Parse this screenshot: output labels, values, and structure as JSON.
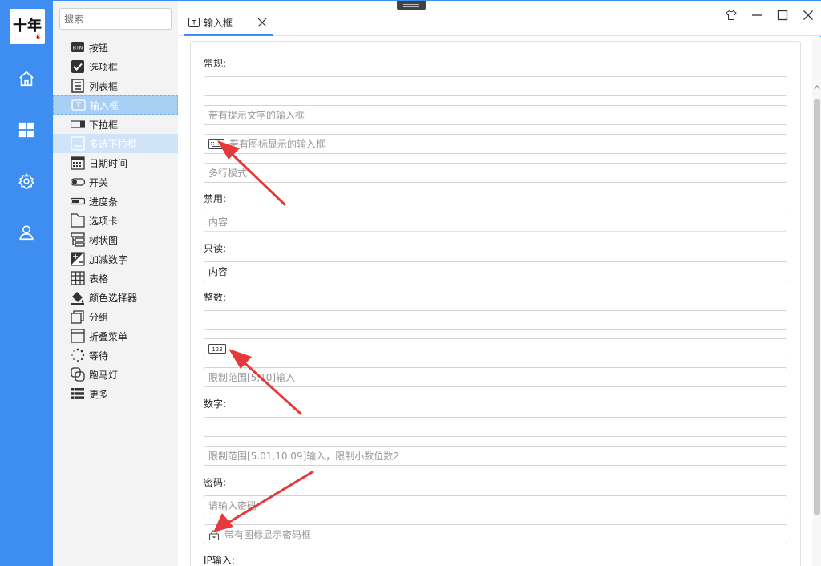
{
  "logo": {
    "text": "十年",
    "sub": "6"
  },
  "rail": {
    "items": [
      "home-icon",
      "dashboard-icon",
      "settings-icon",
      "user-icon"
    ]
  },
  "sidebar": {
    "search_placeholder": "搜索",
    "items": [
      {
        "label": "按钮",
        "icon": "btn-icon"
      },
      {
        "label": "选项框",
        "icon": "checkbox-icon"
      },
      {
        "label": "列表框",
        "icon": "listbox-icon"
      },
      {
        "label": "输入框",
        "icon": "textbox-icon",
        "active": true
      },
      {
        "label": "下拉框",
        "icon": "dropdown-icon"
      },
      {
        "label": "多选下拉框",
        "icon": "multiselect-icon",
        "hover": true
      },
      {
        "label": "日期时间",
        "icon": "calendar-icon"
      },
      {
        "label": "开关",
        "icon": "toggle-icon"
      },
      {
        "label": "进度条",
        "icon": "progress-icon"
      },
      {
        "label": "选项卡",
        "icon": "tab-icon"
      },
      {
        "label": "树状图",
        "icon": "tree-icon"
      },
      {
        "label": "加减数字",
        "icon": "plusminus-icon"
      },
      {
        "label": "表格",
        "icon": "table-icon"
      },
      {
        "label": "颜色选择器",
        "icon": "paint-bucket-icon"
      },
      {
        "label": "分组",
        "icon": "group-icon"
      },
      {
        "label": "折叠菜单",
        "icon": "collapse-menu-icon"
      },
      {
        "label": "等待",
        "icon": "spinner-icon"
      },
      {
        "label": "跑马灯",
        "icon": "marquee-icon"
      },
      {
        "label": "更多",
        "icon": "more-icon"
      }
    ]
  },
  "tab": {
    "label": "输入框"
  },
  "window": {
    "buttons": [
      "skin-icon",
      "minimize-icon",
      "maximize-icon",
      "close-icon"
    ]
  },
  "form": {
    "normal_label": "常规:",
    "normal_value": "",
    "hint_placeholder": "带有提示文字的输入框",
    "icon_placeholder": "带有图标显示的输入框",
    "multiline_placeholder": "多行模式",
    "disabled_label": "禁用:",
    "disabled_value": "内容",
    "readonly_label": "只读:",
    "readonly_value": "内容",
    "integer_label": "整数:",
    "integer_value": "",
    "integer_icon_value": "",
    "integer_range_placeholder": "限制范围[5,10]输入",
    "number_label": "数字:",
    "number_value": "",
    "number_range_placeholder": "限制范围[5.01,10.09]输入，限制小数位数2",
    "password_label": "密码:",
    "password_placeholder": "请输入密码",
    "password_icon_placeholder": "带有图标显示密码框",
    "ip_label": "IP输入:"
  },
  "colors": {
    "accent": "#3d8ef0",
    "arrow": "#e8393a"
  }
}
